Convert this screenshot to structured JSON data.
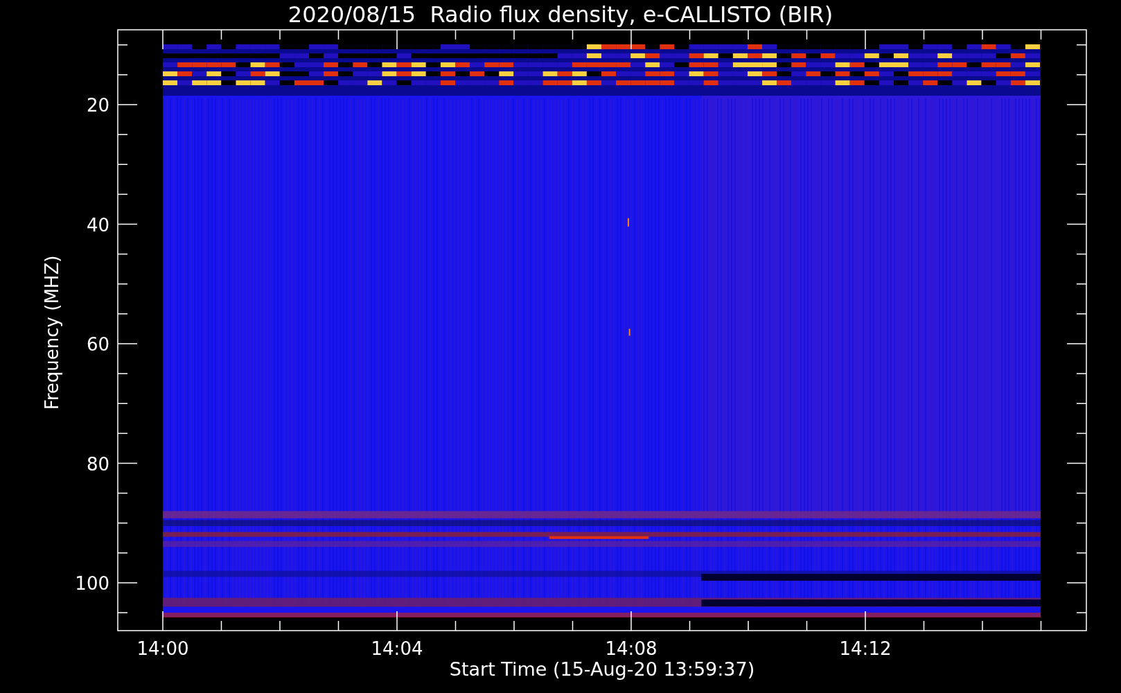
{
  "title": "2020/08/15  Radio flux density, e-CALLISTO (BIR)",
  "y_axis": {
    "label": "Frequency (MHZ)",
    "ticks": [
      "20",
      "40",
      "60",
      "80",
      "100"
    ]
  },
  "x_axis": {
    "label": "Start Time (15-Aug-20 13:59:37)",
    "ticks": [
      "14:00",
      "14:04",
      "14:08",
      "14:12"
    ]
  }
}
